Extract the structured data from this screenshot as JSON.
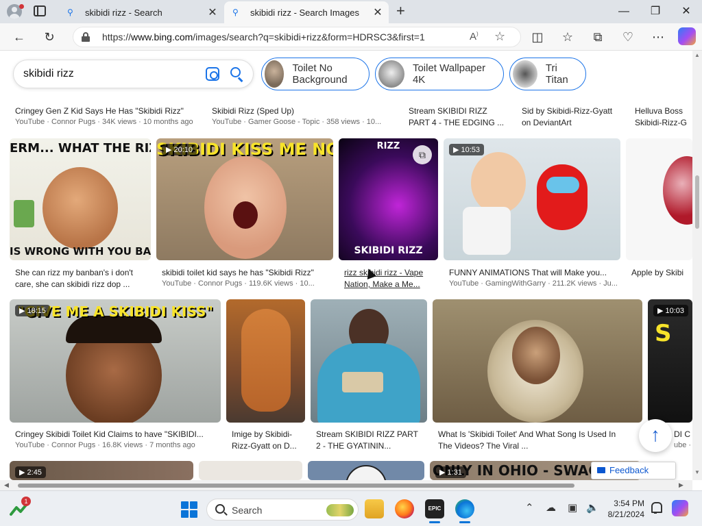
{
  "browser": {
    "tabs": [
      {
        "title": "skibidi rizz - Search",
        "active": false
      },
      {
        "title": "skibidi rizz - Search Images",
        "active": true
      }
    ],
    "url_prefix": "https://",
    "url_host": "www.bing.com",
    "url_path": "/images/search?q=skibidi+rizz&form=HDRSC3&first=1",
    "read_aloud": "A"
  },
  "search": {
    "query": "skibidi rizz",
    "chips": [
      {
        "label": "Toilet No Background"
      },
      {
        "label": "Toilet Wallpaper 4K"
      },
      {
        "label": "Tri Titan"
      }
    ]
  },
  "results": {
    "row0": [
      {
        "caption": "Cringey Gen Z Kid Says He Has \"Skibidi Rizz\"",
        "meta": "YouTube · Connor Pugs · 34K views · 10 months ago"
      },
      {
        "caption": "Skibidi Rizz (Sped Up)",
        "meta": "YouTube · Gamer Goose - Topic · 358 views · 10..."
      },
      {
        "caption": "Stream SKIBIDI RIZZ",
        "caption2": "PART 4 - THE EDGING ..."
      },
      {
        "caption": "Sid by Skibidi-Rizz-Gyatt",
        "caption2": "on DeviantArt"
      },
      {
        "caption": "Helluva Boss",
        "caption2": "Skibidi-Rizz-G"
      }
    ],
    "row1": [
      {
        "overlay": "ERM... WHAT THE RIZ",
        "overlay2": "IS WRONG WITH YOU BA",
        "caption": "She can rizz my banban's i don't",
        "caption2": "care, she can skibidi rizz dop ..."
      },
      {
        "duration": "20:10",
        "overlay": "SKIBIDI KISS ME NOW",
        "caption": "skibidi toilet kid says he has \"Skibidi Rizz\"",
        "meta": "YouTube · Connor Pugs · 119.6K views · 10..."
      },
      {
        "overlay": "RIZZ",
        "overlay2": "SKIBIDI RIZZ",
        "caption": "rizz skibidi rizz - Vape",
        "caption2": "Nation, Make a Me..."
      },
      {
        "duration": "10:53",
        "caption": "FUNNY ANIMATIONS That will Make you...",
        "meta": "YouTube · GamingWithGarry · 211.2K views · Ju..."
      },
      {
        "caption": "Apple by Skibi"
      }
    ],
    "row2": [
      {
        "duration": "18:15",
        "overlay": "\"GIVE ME A SKIBIDI KISS\"",
        "caption": "Cringey Skibidi Toilet Kid Claims to have \"SKIBIDI...",
        "meta": "YouTube · Connor Pugs · 16.8K views · 7 months ago"
      },
      {
        "caption": "Imige by Skibidi-",
        "caption2": "Rizz-Gyatt on D..."
      },
      {
        "caption": "Stream SKIBIDI RIZZ PART",
        "caption2": "2 - THE GYATININ..."
      },
      {
        "caption": "What Is 'Skibidi Toilet' And What Song Is Used In",
        "caption2": "The Videos? The Viral ..."
      },
      {
        "duration": "10:03",
        "caption": "DI C",
        "meta": "ube ·"
      }
    ],
    "row3": [
      {
        "duration": "2:45"
      },
      {},
      {},
      {
        "duration": "1:31",
        "overlay": "ONLY IN OHIO - SWAG LIKE"
      }
    ]
  },
  "feedback_label": "Feedback",
  "taskbar": {
    "widget_badge": "1",
    "search_label": "Search",
    "time": "3:54 PM",
    "date": "8/21/2024"
  },
  "colors": {
    "accent": "#1a73e8",
    "chrome_bg": "#dfe3e8",
    "taskbar_bg": "#eceff3"
  }
}
